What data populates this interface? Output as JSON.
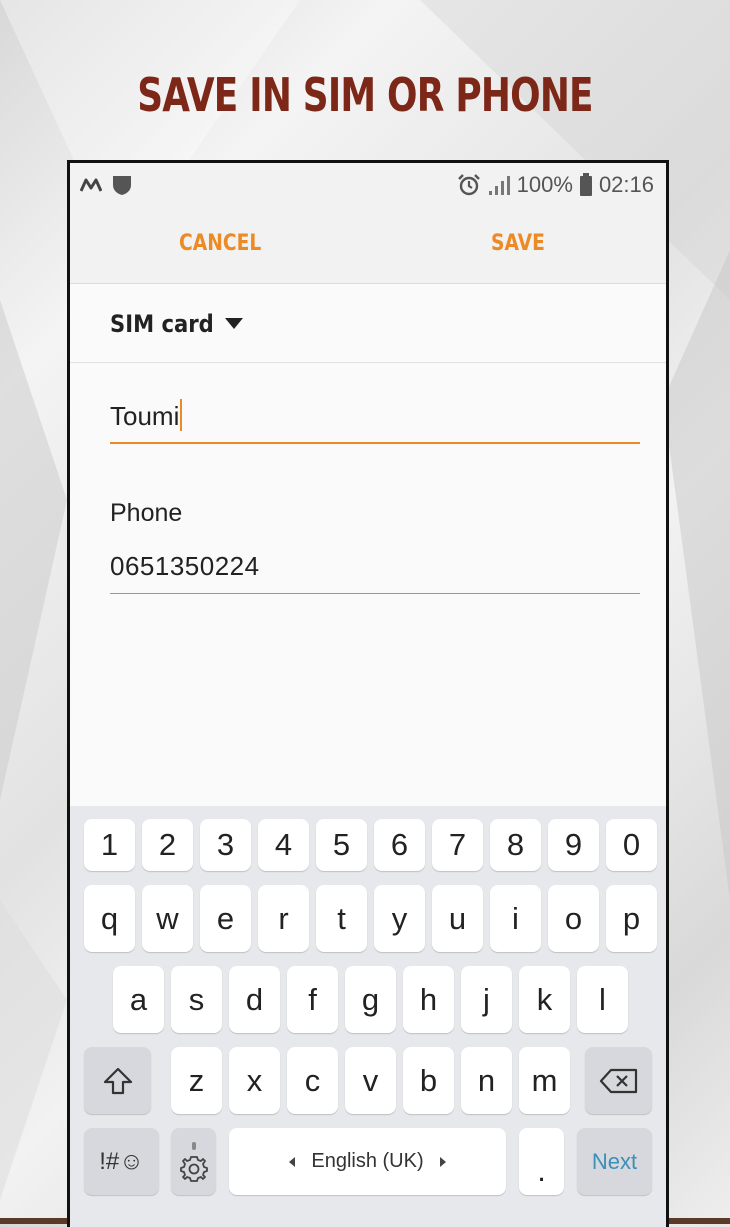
{
  "headline": "SAVE IN SIM OR PHONE",
  "status_bar": {
    "left_icons": [
      "m-logo-icon",
      "shield-icon"
    ],
    "alarm_icon": "alarm-icon",
    "signal_icon": "signal-icon",
    "battery_percent": "100%",
    "battery_icon": "battery-icon",
    "time": "02:16"
  },
  "action_bar": {
    "cancel_label": "CANCEL",
    "save_label": "SAVE"
  },
  "storage": {
    "selected": "SIM card"
  },
  "name_field": {
    "value": "Toumi"
  },
  "phone_field": {
    "label": "Phone",
    "value": "0651350224"
  },
  "keyboard": {
    "row1": [
      "1",
      "2",
      "3",
      "4",
      "5",
      "6",
      "7",
      "8",
      "9",
      "0"
    ],
    "row2": [
      "q",
      "w",
      "e",
      "r",
      "t",
      "y",
      "u",
      "i",
      "o",
      "p"
    ],
    "row3": [
      "a",
      "s",
      "d",
      "f",
      "g",
      "h",
      "j",
      "k",
      "l"
    ],
    "row4": [
      "z",
      "x",
      "c",
      "v",
      "b",
      "n",
      "m"
    ],
    "symbols_label": "!#☺",
    "language_label": "English (UK)",
    "period_label": ".",
    "next_label": "Next"
  }
}
